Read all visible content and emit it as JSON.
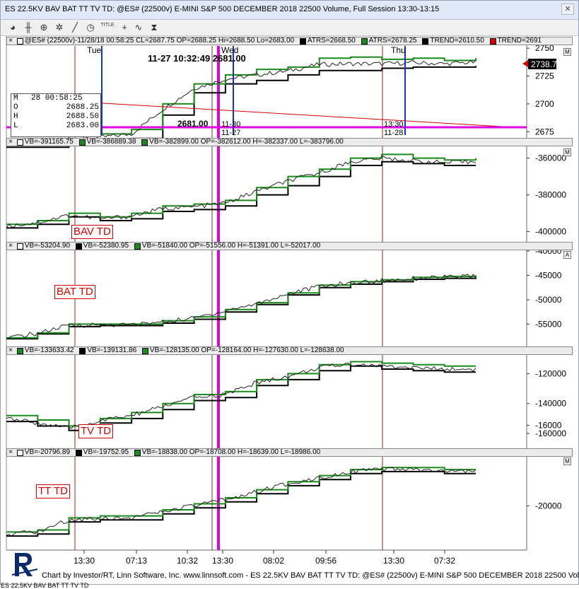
{
  "window": {
    "title": "ES 22.5KV BAV BAT TT TV TD: @ES# (22500v) E-MINI S&P 500 DECEMBER 2018 22500 Volume, Full Session 13:30-13:15",
    "close_glyph": "✕"
  },
  "toolbar": {
    "title_button": "TITLE"
  },
  "price_panel": {
    "legend_close": "×",
    "legend_items": [
      {
        "text": "@ES# (22500v)-11/28/18 00:58:25 CL=2687.75 OP=2688.25 Hi=2688.50 Lo=2683.00",
        "color": "#ffffff"
      },
      {
        "text": "ATRS=2668.50",
        "color": "#000000"
      },
      {
        "text": "ATRS=2678.25",
        "color": "#1a8a1a"
      },
      {
        "text": "TREND=2610.50",
        "color": "#000000"
      },
      {
        "text": "TREND=2691",
        "color": "#d40000"
      }
    ],
    "day_labels": [
      "Tue",
      "Wed",
      "Thu"
    ],
    "cursor_datetime": "11-27 10:32:49  2681.00",
    "price_callout": "2681.00",
    "marker_label_a": "11-30",
    "marker_label_b": "11-27",
    "thu_time": "13:30",
    "thu_date": "11-28",
    "last_price": "2738.75",
    "axis_ticks": [
      {
        "label": "2750",
        "value": 2750
      },
      {
        "label": "2725",
        "value": 2725
      },
      {
        "label": "2700",
        "value": 2700
      },
      {
        "label": "2675",
        "value": 2675
      }
    ],
    "ohlc": {
      "header_key": "M",
      "header_val": "28 00:58:25",
      "open_key": "O",
      "open_val": "2688.25",
      "high_key": "H",
      "high_val": "2688.50",
      "low_key": "L",
      "low_val": "2683.00"
    },
    "side_button": "M"
  },
  "panels": [
    {
      "id": "bav",
      "label": "BAV TD",
      "legend_items": [
        {
          "text": "VB=-391165.75",
          "color": "#ffffff"
        },
        {
          "text": "VB=-386889.38",
          "color": "#1a8a1a"
        },
        {
          "text": "VB=-382899.00 OP=-382612.00 H=-382337.00 L=-383796.00",
          "color": "#1a8a1a"
        }
      ],
      "axis_ticks": [
        {
          "label": "-360000",
          "value": -360000
        },
        {
          "label": "-380000",
          "value": -380000
        },
        {
          "label": "-400000",
          "value": -400000
        }
      ],
      "side_button": "M"
    },
    {
      "id": "bat",
      "label": "BAT TD",
      "legend_items": [
        {
          "text": "VB=-53204.90",
          "color": "#ffffff"
        },
        {
          "text": "VB=-52380.95",
          "color": "#000000"
        },
        {
          "text": "VB=-51840.00 OP=-51556.00 H=-51391.00 L=-52017.00",
          "color": "#1a8a1a"
        }
      ],
      "axis_ticks": [
        {
          "label": "-40000",
          "value": -40000
        },
        {
          "label": "-45000",
          "value": -45000
        },
        {
          "label": "-50000",
          "value": -50000
        },
        {
          "label": "-55000",
          "value": -55000
        }
      ],
      "side_button": "A"
    },
    {
      "id": "tv",
      "label": "TV TD",
      "legend_items": [
        {
          "text": "VB=-133633.42",
          "color": "#1a8a1a"
        },
        {
          "text": "VB=-139131.86",
          "color": "#000000"
        },
        {
          "text": "VB=-128135.00 OP=-128164.00 H=-127630.00 L=-128638.00",
          "color": "#1a8a1a"
        }
      ],
      "axis_ticks": [
        {
          "label": "-120000",
          "value": -120000
        },
        {
          "label": "-140000",
          "value": -140000
        },
        {
          "label": "-160000",
          "value": -160000
        }
      ],
      "side_button": ""
    },
    {
      "id": "tt",
      "label": "TT TD",
      "legend_items": [
        {
          "text": "VB=-20796.89",
          "color": "#ffffff"
        },
        {
          "text": "VB=-19752.95",
          "color": "#000000"
        },
        {
          "text": "VB=-18838.00 OP=-18708.00 H=-18639.00 L=-18986.00",
          "color": "#1a8a1a"
        }
      ],
      "axis_ticks": [
        {
          "label": "-16000",
          "value": -16000
        },
        {
          "label": "-20000",
          "value": -20000
        }
      ],
      "side_button": "M"
    }
  ],
  "time_axis": {
    "labels": [
      "13:30",
      "07:13",
      "10:32",
      "13:30",
      "08:02",
      "09:56",
      "13:30",
      "07:32"
    ]
  },
  "status_bar": {
    "text": "Chart by Investor/RT, Linn Software, Inc. www.linnsoft.com - ES 22.5KV BAV BAT TT TV TD: @ES# (22500v) E-MINI S&P 500 DECEMBER 2018 22500 Volume"
  },
  "tab_strip": {
    "text": "ES 22.5KV BAV BAT TT TV TD"
  },
  "colors": {
    "series_black": "#000000",
    "series_green": "#1a8a1a",
    "trend_red": "#d40000",
    "cursor_magenta": "#e000e0",
    "marker_blue": "#1a2fd0",
    "session_line": "#9b1c1c",
    "grid": "#dadada"
  },
  "chart_data": [
    {
      "type": "line",
      "panel": "price",
      "title": "",
      "series": [
        {
          "name": "ATRS=2668.50",
          "values": [
            2661,
            2661,
            2664,
            2667,
            2669,
            2690,
            2710,
            2718,
            2721,
            2726,
            2730,
            2730,
            2732,
            2733,
            2733,
            2734
          ]
        },
        {
          "name": "ATRS=2678.25",
          "values": [
            2666,
            2667,
            2671,
            2673,
            2677,
            2700,
            2718,
            2726,
            2731,
            2733,
            2741,
            2742,
            2740,
            2741,
            2739,
            2741
          ]
        }
      ],
      "ylim": [
        2672,
        2752
      ]
    },
    {
      "type": "line",
      "panel": "bav",
      "series": [
        {
          "name": "VB=-386889.38",
          "values": [
            -398000,
            -396000,
            -392000,
            -394000,
            -393000,
            -389000,
            -388000,
            -386000,
            -380000,
            -375000,
            -370000,
            -364000,
            -362000,
            -363000,
            -364000,
            -364000
          ]
        },
        {
          "name": "VB=-382899.00",
          "values": [
            -396000,
            -394000,
            -390000,
            -392000,
            -390000,
            -386000,
            -385000,
            -383000,
            -376000,
            -370000,
            -366000,
            -360000,
            -358000,
            -360000,
            -361000,
            -360000
          ]
        }
      ],
      "ylim": [
        -404000,
        -354000
      ]
    },
    {
      "type": "line",
      "panel": "bat",
      "series": [
        {
          "name": "VB=-52380.95",
          "values": [
            -58000,
            -57000,
            -55500,
            -55300,
            -55300,
            -54800,
            -54000,
            -52500,
            -51000,
            -49000,
            -47500,
            -46800,
            -46300,
            -45800,
            -45600,
            -45400
          ]
        },
        {
          "name": "VB=-51840.00",
          "values": [
            -57800,
            -56800,
            -55000,
            -55000,
            -55000,
            -54300,
            -53500,
            -52000,
            -50600,
            -48600,
            -47000,
            -46300,
            -45900,
            -45400,
            -45200,
            -45000
          ]
        }
      ],
      "ylim": [
        -59000,
        -40000
      ]
    },
    {
      "type": "line",
      "panel": "tv",
      "series": [
        {
          "name": "VB=-139131.86",
          "values": [
            -152000,
            -155000,
            -158000,
            -153000,
            -150000,
            -144000,
            -138000,
            -136000,
            -128000,
            -124000,
            -118000,
            -115000,
            -117000,
            -118000,
            -119000,
            -119000
          ]
        },
        {
          "name": "VB=-128135.00",
          "values": [
            -148000,
            -151000,
            -155000,
            -150000,
            -146000,
            -140000,
            -134000,
            -132000,
            -124000,
            -120000,
            -114000,
            -112000,
            -113000,
            -114000,
            -115000,
            -115000
          ]
        }
      ],
      "ylim": [
        -168000,
        -108000
      ]
    },
    {
      "type": "line",
      "panel": "tt",
      "series": [
        {
          "name": "VB=-19752.95",
          "values": [
            -21500,
            -21400,
            -20800,
            -20700,
            -20700,
            -20400,
            -20100,
            -19800,
            -19400,
            -19000,
            -18700,
            -18400,
            -18300,
            -18300,
            -18400,
            -18400
          ]
        },
        {
          "name": "VB=-18838.00",
          "values": [
            -21300,
            -21200,
            -20600,
            -20500,
            -20500,
            -20200,
            -19900,
            -19600,
            -19200,
            -18800,
            -18500,
            -18200,
            -18100,
            -18100,
            -18200,
            -18200
          ]
        }
      ],
      "ylim": [
        -22200,
        -17600
      ]
    }
  ]
}
